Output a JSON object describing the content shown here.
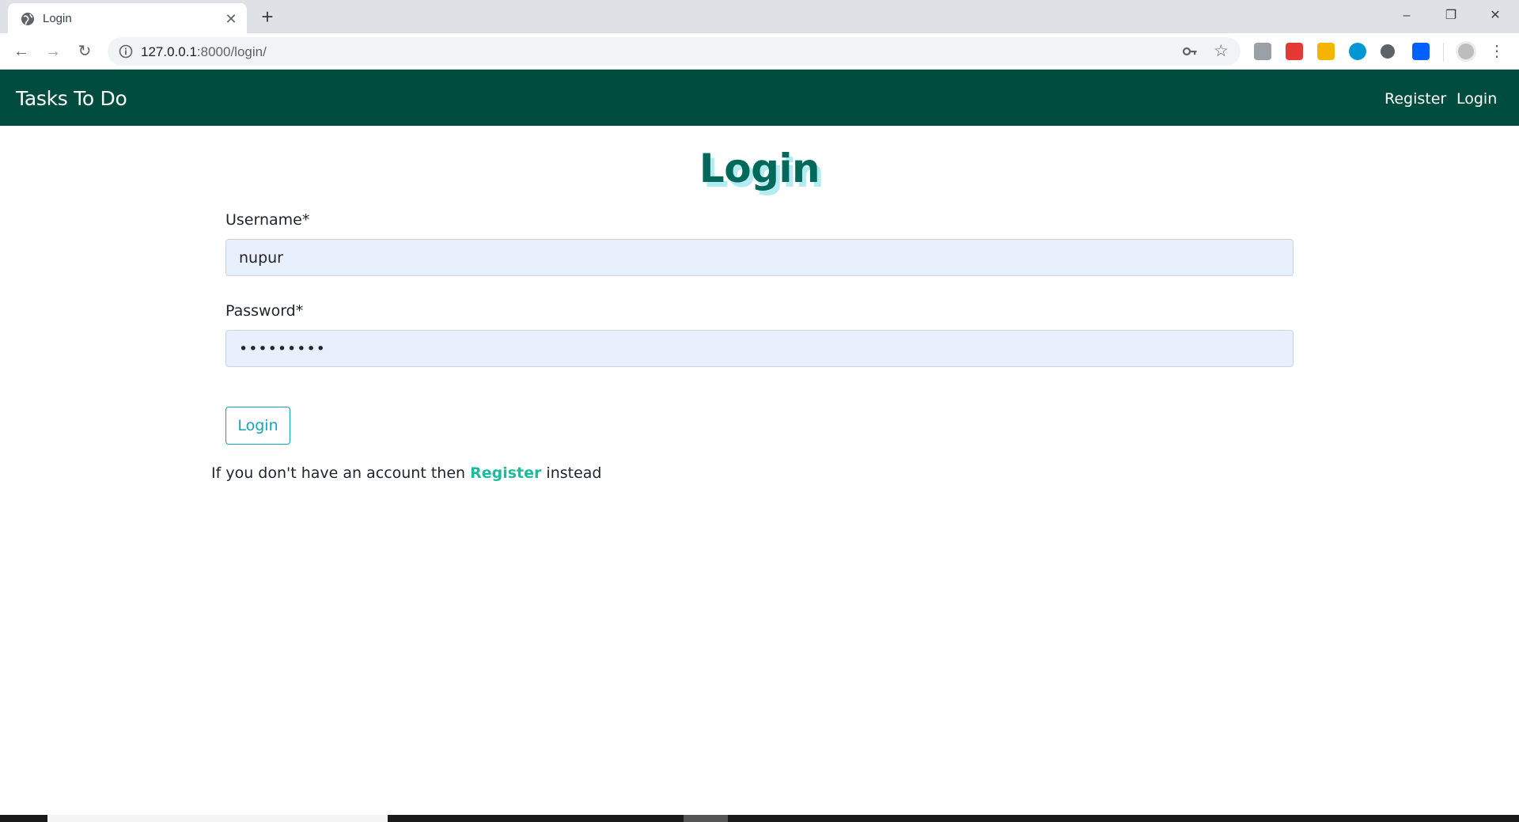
{
  "browser": {
    "tab_title": "Login",
    "url_host": "127.0.0.1",
    "url_path": ":8000/login/",
    "close_glyph": "✕",
    "new_tab_glyph": "+",
    "minimize_glyph": "–",
    "restore_glyph": "❐",
    "window_close_glyph": "✕",
    "back_glyph": "←",
    "forward_glyph": "→",
    "reload_glyph": "↻",
    "star_glyph": "☆",
    "menu_glyph": "⋮",
    "extensions": [
      {
        "name": "readability-extension-icon",
        "color": "#9aa0a6"
      },
      {
        "name": "red-extension-icon",
        "color": "#e53935"
      },
      {
        "name": "w-extension-icon",
        "color": "#f4b400"
      },
      {
        "name": "hp-extension-icon",
        "color": "#0096d6"
      },
      {
        "name": "circle-extension-icon",
        "color": "#5f6368"
      },
      {
        "name": "dropbox-extension-icon",
        "color": "#0061fe"
      }
    ]
  },
  "navbar": {
    "brand": "Tasks To Do",
    "links": [
      "Register",
      "Login"
    ]
  },
  "main": {
    "title": "Login",
    "username_label": "Username*",
    "username_value": "nupur",
    "password_label": "Password*",
    "password_value": "•••••••••",
    "submit_label": "Login",
    "helper_prefix": "If you don't have an account then ",
    "helper_link": "Register",
    "helper_suffix": " instead"
  },
  "colors": {
    "navbar_bg": "#004d40",
    "title": "#00695c",
    "title_shadow": "#b2ebf2",
    "button": "#17a2b8",
    "link": "#1abc9c",
    "input_bg": "#e8f0fe"
  }
}
